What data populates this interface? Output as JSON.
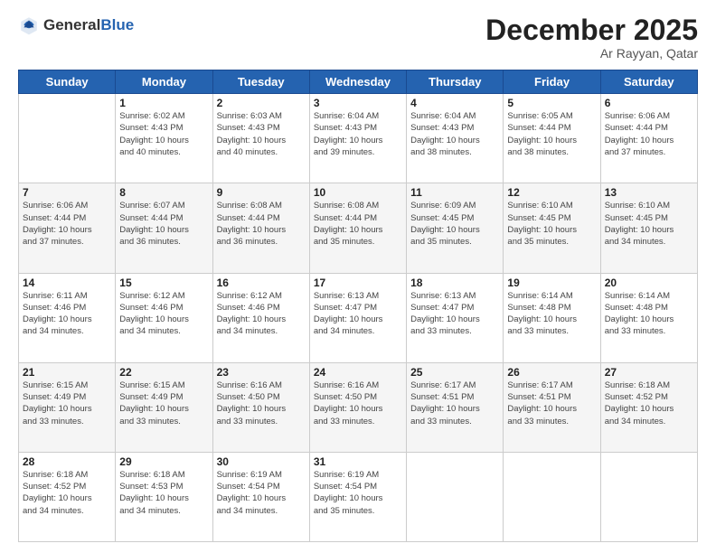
{
  "header": {
    "logo_general": "General",
    "logo_blue": "Blue",
    "month_title": "December 2025",
    "subtitle": "Ar Rayyan, Qatar"
  },
  "days_of_week": [
    "Sunday",
    "Monday",
    "Tuesday",
    "Wednesday",
    "Thursday",
    "Friday",
    "Saturday"
  ],
  "weeks": [
    [
      {
        "day": "",
        "info": ""
      },
      {
        "day": "1",
        "info": "Sunrise: 6:02 AM\nSunset: 4:43 PM\nDaylight: 10 hours\nand 40 minutes."
      },
      {
        "day": "2",
        "info": "Sunrise: 6:03 AM\nSunset: 4:43 PM\nDaylight: 10 hours\nand 40 minutes."
      },
      {
        "day": "3",
        "info": "Sunrise: 6:04 AM\nSunset: 4:43 PM\nDaylight: 10 hours\nand 39 minutes."
      },
      {
        "day": "4",
        "info": "Sunrise: 6:04 AM\nSunset: 4:43 PM\nDaylight: 10 hours\nand 38 minutes."
      },
      {
        "day": "5",
        "info": "Sunrise: 6:05 AM\nSunset: 4:44 PM\nDaylight: 10 hours\nand 38 minutes."
      },
      {
        "day": "6",
        "info": "Sunrise: 6:06 AM\nSunset: 4:44 PM\nDaylight: 10 hours\nand 37 minutes."
      }
    ],
    [
      {
        "day": "7",
        "info": "Sunrise: 6:06 AM\nSunset: 4:44 PM\nDaylight: 10 hours\nand 37 minutes."
      },
      {
        "day": "8",
        "info": "Sunrise: 6:07 AM\nSunset: 4:44 PM\nDaylight: 10 hours\nand 36 minutes."
      },
      {
        "day": "9",
        "info": "Sunrise: 6:08 AM\nSunset: 4:44 PM\nDaylight: 10 hours\nand 36 minutes."
      },
      {
        "day": "10",
        "info": "Sunrise: 6:08 AM\nSunset: 4:44 PM\nDaylight: 10 hours\nand 35 minutes."
      },
      {
        "day": "11",
        "info": "Sunrise: 6:09 AM\nSunset: 4:45 PM\nDaylight: 10 hours\nand 35 minutes."
      },
      {
        "day": "12",
        "info": "Sunrise: 6:10 AM\nSunset: 4:45 PM\nDaylight: 10 hours\nand 35 minutes."
      },
      {
        "day": "13",
        "info": "Sunrise: 6:10 AM\nSunset: 4:45 PM\nDaylight: 10 hours\nand 34 minutes."
      }
    ],
    [
      {
        "day": "14",
        "info": "Sunrise: 6:11 AM\nSunset: 4:46 PM\nDaylight: 10 hours\nand 34 minutes."
      },
      {
        "day": "15",
        "info": "Sunrise: 6:12 AM\nSunset: 4:46 PM\nDaylight: 10 hours\nand 34 minutes."
      },
      {
        "day": "16",
        "info": "Sunrise: 6:12 AM\nSunset: 4:46 PM\nDaylight: 10 hours\nand 34 minutes."
      },
      {
        "day": "17",
        "info": "Sunrise: 6:13 AM\nSunset: 4:47 PM\nDaylight: 10 hours\nand 34 minutes."
      },
      {
        "day": "18",
        "info": "Sunrise: 6:13 AM\nSunset: 4:47 PM\nDaylight: 10 hours\nand 33 minutes."
      },
      {
        "day": "19",
        "info": "Sunrise: 6:14 AM\nSunset: 4:48 PM\nDaylight: 10 hours\nand 33 minutes."
      },
      {
        "day": "20",
        "info": "Sunrise: 6:14 AM\nSunset: 4:48 PM\nDaylight: 10 hours\nand 33 minutes."
      }
    ],
    [
      {
        "day": "21",
        "info": "Sunrise: 6:15 AM\nSunset: 4:49 PM\nDaylight: 10 hours\nand 33 minutes."
      },
      {
        "day": "22",
        "info": "Sunrise: 6:15 AM\nSunset: 4:49 PM\nDaylight: 10 hours\nand 33 minutes."
      },
      {
        "day": "23",
        "info": "Sunrise: 6:16 AM\nSunset: 4:50 PM\nDaylight: 10 hours\nand 33 minutes."
      },
      {
        "day": "24",
        "info": "Sunrise: 6:16 AM\nSunset: 4:50 PM\nDaylight: 10 hours\nand 33 minutes."
      },
      {
        "day": "25",
        "info": "Sunrise: 6:17 AM\nSunset: 4:51 PM\nDaylight: 10 hours\nand 33 minutes."
      },
      {
        "day": "26",
        "info": "Sunrise: 6:17 AM\nSunset: 4:51 PM\nDaylight: 10 hours\nand 33 minutes."
      },
      {
        "day": "27",
        "info": "Sunrise: 6:18 AM\nSunset: 4:52 PM\nDaylight: 10 hours\nand 34 minutes."
      }
    ],
    [
      {
        "day": "28",
        "info": "Sunrise: 6:18 AM\nSunset: 4:52 PM\nDaylight: 10 hours\nand 34 minutes."
      },
      {
        "day": "29",
        "info": "Sunrise: 6:18 AM\nSunset: 4:53 PM\nDaylight: 10 hours\nand 34 minutes."
      },
      {
        "day": "30",
        "info": "Sunrise: 6:19 AM\nSunset: 4:54 PM\nDaylight: 10 hours\nand 34 minutes."
      },
      {
        "day": "31",
        "info": "Sunrise: 6:19 AM\nSunset: 4:54 PM\nDaylight: 10 hours\nand 35 minutes."
      },
      {
        "day": "",
        "info": ""
      },
      {
        "day": "",
        "info": ""
      },
      {
        "day": "",
        "info": ""
      }
    ]
  ]
}
